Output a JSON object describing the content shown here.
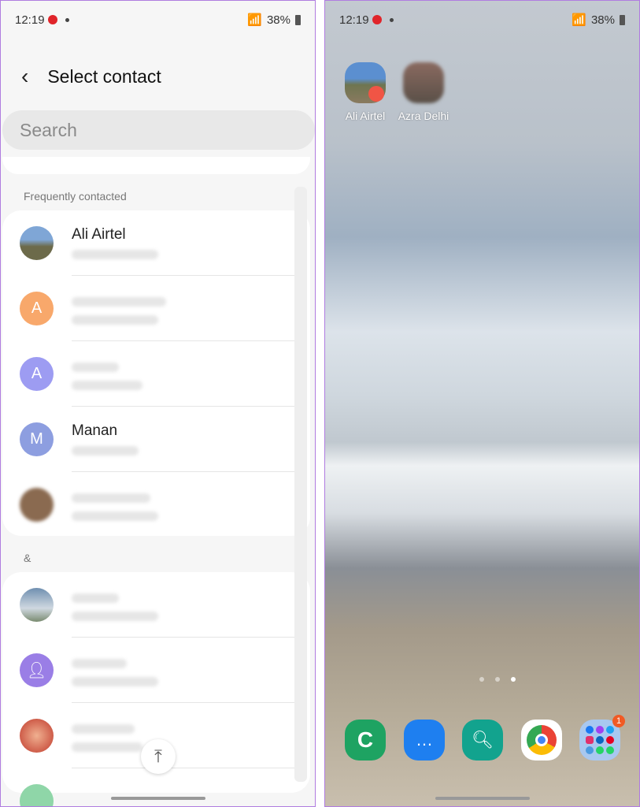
{
  "status_bar": {
    "time": "12:19",
    "battery": "38%"
  },
  "left": {
    "header": {
      "title": "Select contact"
    },
    "search": {
      "placeholder": "Search"
    },
    "sections": [
      {
        "label": "Frequently contacted",
        "contacts": [
          {
            "name": "Ali Airtel",
            "initial": "",
            "color": "#6c8a5a"
          },
          {
            "name": "",
            "initial": "A",
            "color": "#f8a86b"
          },
          {
            "name": "",
            "initial": "A",
            "color": "#9d9cf2"
          },
          {
            "name": "Manan",
            "initial": "M",
            "color": "#8d9ee0"
          },
          {
            "name": "",
            "initial": "",
            "color": "#8a6a50"
          }
        ]
      },
      {
        "label": "&",
        "contacts": [
          {
            "name": "",
            "initial": "",
            "color": "#6f8fb0"
          },
          {
            "name": "",
            "initial": "person-icon",
            "color": "#9a7ee6"
          },
          {
            "name": "",
            "initial": "",
            "color": "#c0392b"
          }
        ]
      }
    ],
    "scroll_top_icon": "chevron-up-to-top-icon"
  },
  "right": {
    "shortcuts": [
      {
        "label": "Ali Airtel"
      },
      {
        "label": "Azra Delhi"
      }
    ],
    "page_indicator": {
      "pages": 3,
      "current": 3
    },
    "dock": [
      {
        "app": "Phone",
        "color": "#1ea362"
      },
      {
        "app": "Messages",
        "color": "#1e7ff0"
      },
      {
        "app": "Quick Search",
        "color": "#12a38e"
      },
      {
        "app": "Chrome",
        "color": "#ffffff"
      },
      {
        "app": "Social folder",
        "color": "#a8c8f0",
        "badge": "1"
      }
    ]
  }
}
